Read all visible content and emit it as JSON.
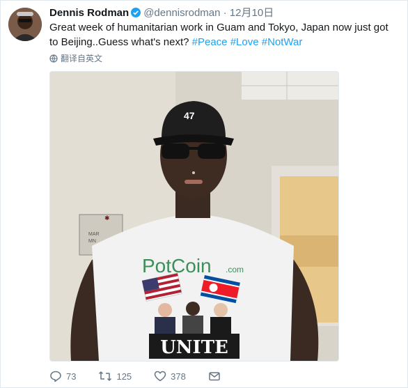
{
  "tweet": {
    "author_name": "Dennis Rodman",
    "handle": "@dennisrodman",
    "separator": "·",
    "date": "12月10日",
    "text_before": "Great week of humanitarian work in Guam and Tokyo, Japan now just got to Beijing..Guess what's next? ",
    "hashtags": [
      "#Peace",
      "#Love",
      "#NotWar"
    ],
    "translate_label": "翻译自英文",
    "photo": {
      "cap_text": "47",
      "shirt_brand": "PotCoin",
      "shirt_brand_suffix": ".com",
      "shirt_slogan": "UNITE"
    },
    "actions": {
      "replies": "73",
      "retweets": "125",
      "likes": "378"
    }
  },
  "colors": {
    "link": "#1da1f2",
    "secondary": "#657786",
    "verified": "#1da1f2",
    "potcoin_green": "#3c8f5a"
  }
}
